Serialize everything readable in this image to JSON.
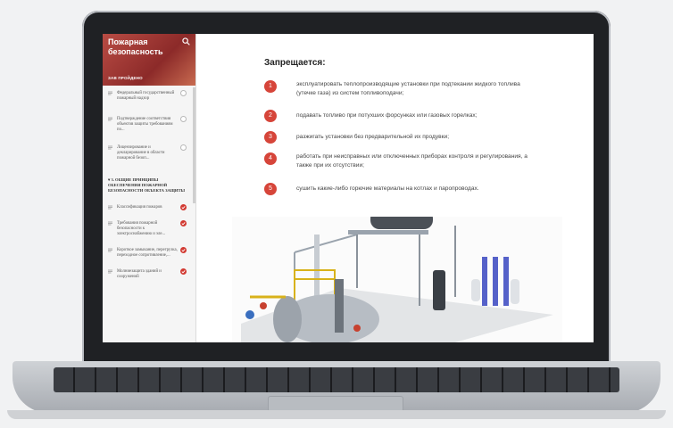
{
  "sidebar": {
    "title": "Пожарная безопасность",
    "subtitle": "ЗАВ ПРОЙДЕНО",
    "items": [
      {
        "label": "Федеральный государственный пожарный надзор",
        "status": "empty"
      },
      {
        "label": "Подтверждение соответствия объектов защиты требованиям по...",
        "status": "empty"
      },
      {
        "label": "Лицензирование и декларирование в области пожарной безоп...",
        "status": "empty"
      },
      {
        "label": "Классификация пожаров",
        "status": "done"
      },
      {
        "label": "Требования пожарной безопасности к электроснабжению и эле...",
        "status": "done"
      },
      {
        "label": "Короткое замыкание, перегрузка, переходное сопротивление,...",
        "status": "done"
      },
      {
        "label": "Молниезащита зданий и сооружений",
        "status": "done"
      }
    ],
    "section": "▾ 3. ОБЩИЕ ПРИНЦИПЫ ОБЕСПЕЧЕНИЯ ПОЖАРНОЙ БЕЗОПАСНОСТИ ОБЪЕКТА ЗАЩИТЫ"
  },
  "main": {
    "heading": "Запрещается:",
    "rules": [
      {
        "num": "1",
        "text": "эксплуатировать теплопроизводящие установки при подтекании жидкого топлива (утечке газа) из систем топливоподачи;"
      },
      {
        "num": "2",
        "text": "подавать топливо при потухших форсунках или газовых горелках;"
      },
      {
        "num": "3",
        "text": "разжигать установки без предварительной их продувки;"
      },
      {
        "num": "4",
        "text": "работать при неисправных или отключенных приборах контроля и регулирования, а также при их отсутствии;"
      },
      {
        "num": "5",
        "text": "сушить какие-либо горючие материалы на котлах и паропроводах."
      }
    ]
  },
  "colors": {
    "accent": "#d6453a",
    "sidebar_header": "#8c2a29"
  },
  "icons": [
    "search-icon",
    "document-icon",
    "check-icon"
  ]
}
